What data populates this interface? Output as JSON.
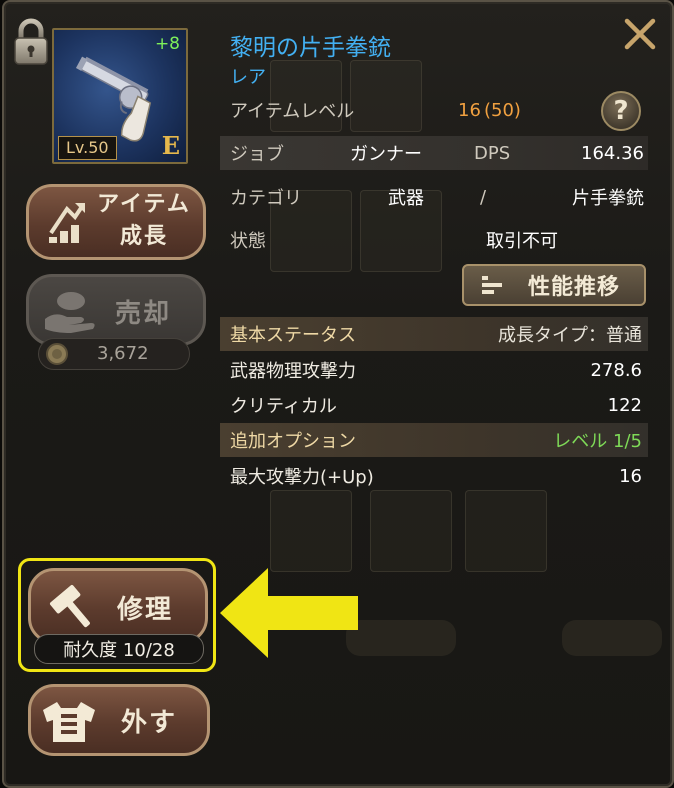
{
  "item": {
    "name": "黎明の片手拳銃",
    "rarity": "レア",
    "enhance": "+8",
    "level_badge": "Lv.50",
    "grade": "E",
    "item_level_label": "アイテムレベル",
    "item_level_value": "16",
    "item_level_max": "(50)"
  },
  "info": {
    "job_label": "ジョブ",
    "job_value": "ガンナー",
    "dps_label": "DPS",
    "dps_value": "164.36",
    "category_label": "カテゴリ",
    "category_value_a": "武器",
    "category_sep": "/",
    "category_value_b": "片手拳銃",
    "state_label": "状態",
    "state_value": "取引不可",
    "performance_button": "性能推移"
  },
  "basic_status": {
    "header": "基本ステータス",
    "growth_type": "成長タイプ：普通",
    "stats": [
      {
        "label": "武器物理攻撃力",
        "value": "278.6"
      },
      {
        "label": "クリティカル",
        "value": "122"
      }
    ]
  },
  "extra_option": {
    "header": "追加オプション",
    "level": "レベル 1/5",
    "stats": [
      {
        "label": "最大攻撃力(+Up)",
        "value": "16"
      }
    ]
  },
  "sidebar": {
    "grow_line1": "アイテム",
    "grow_line2": "成長",
    "sell_label": "売却",
    "sell_price": "3,672",
    "repair_label": "修理",
    "durability": "耐久度 10/28",
    "remove_label": "外す"
  },
  "colors": {
    "title_blue": "#43b0f2",
    "level_orange": "#f0a040",
    "green": "#7ed957",
    "highlight_yellow": "#f0e514"
  }
}
